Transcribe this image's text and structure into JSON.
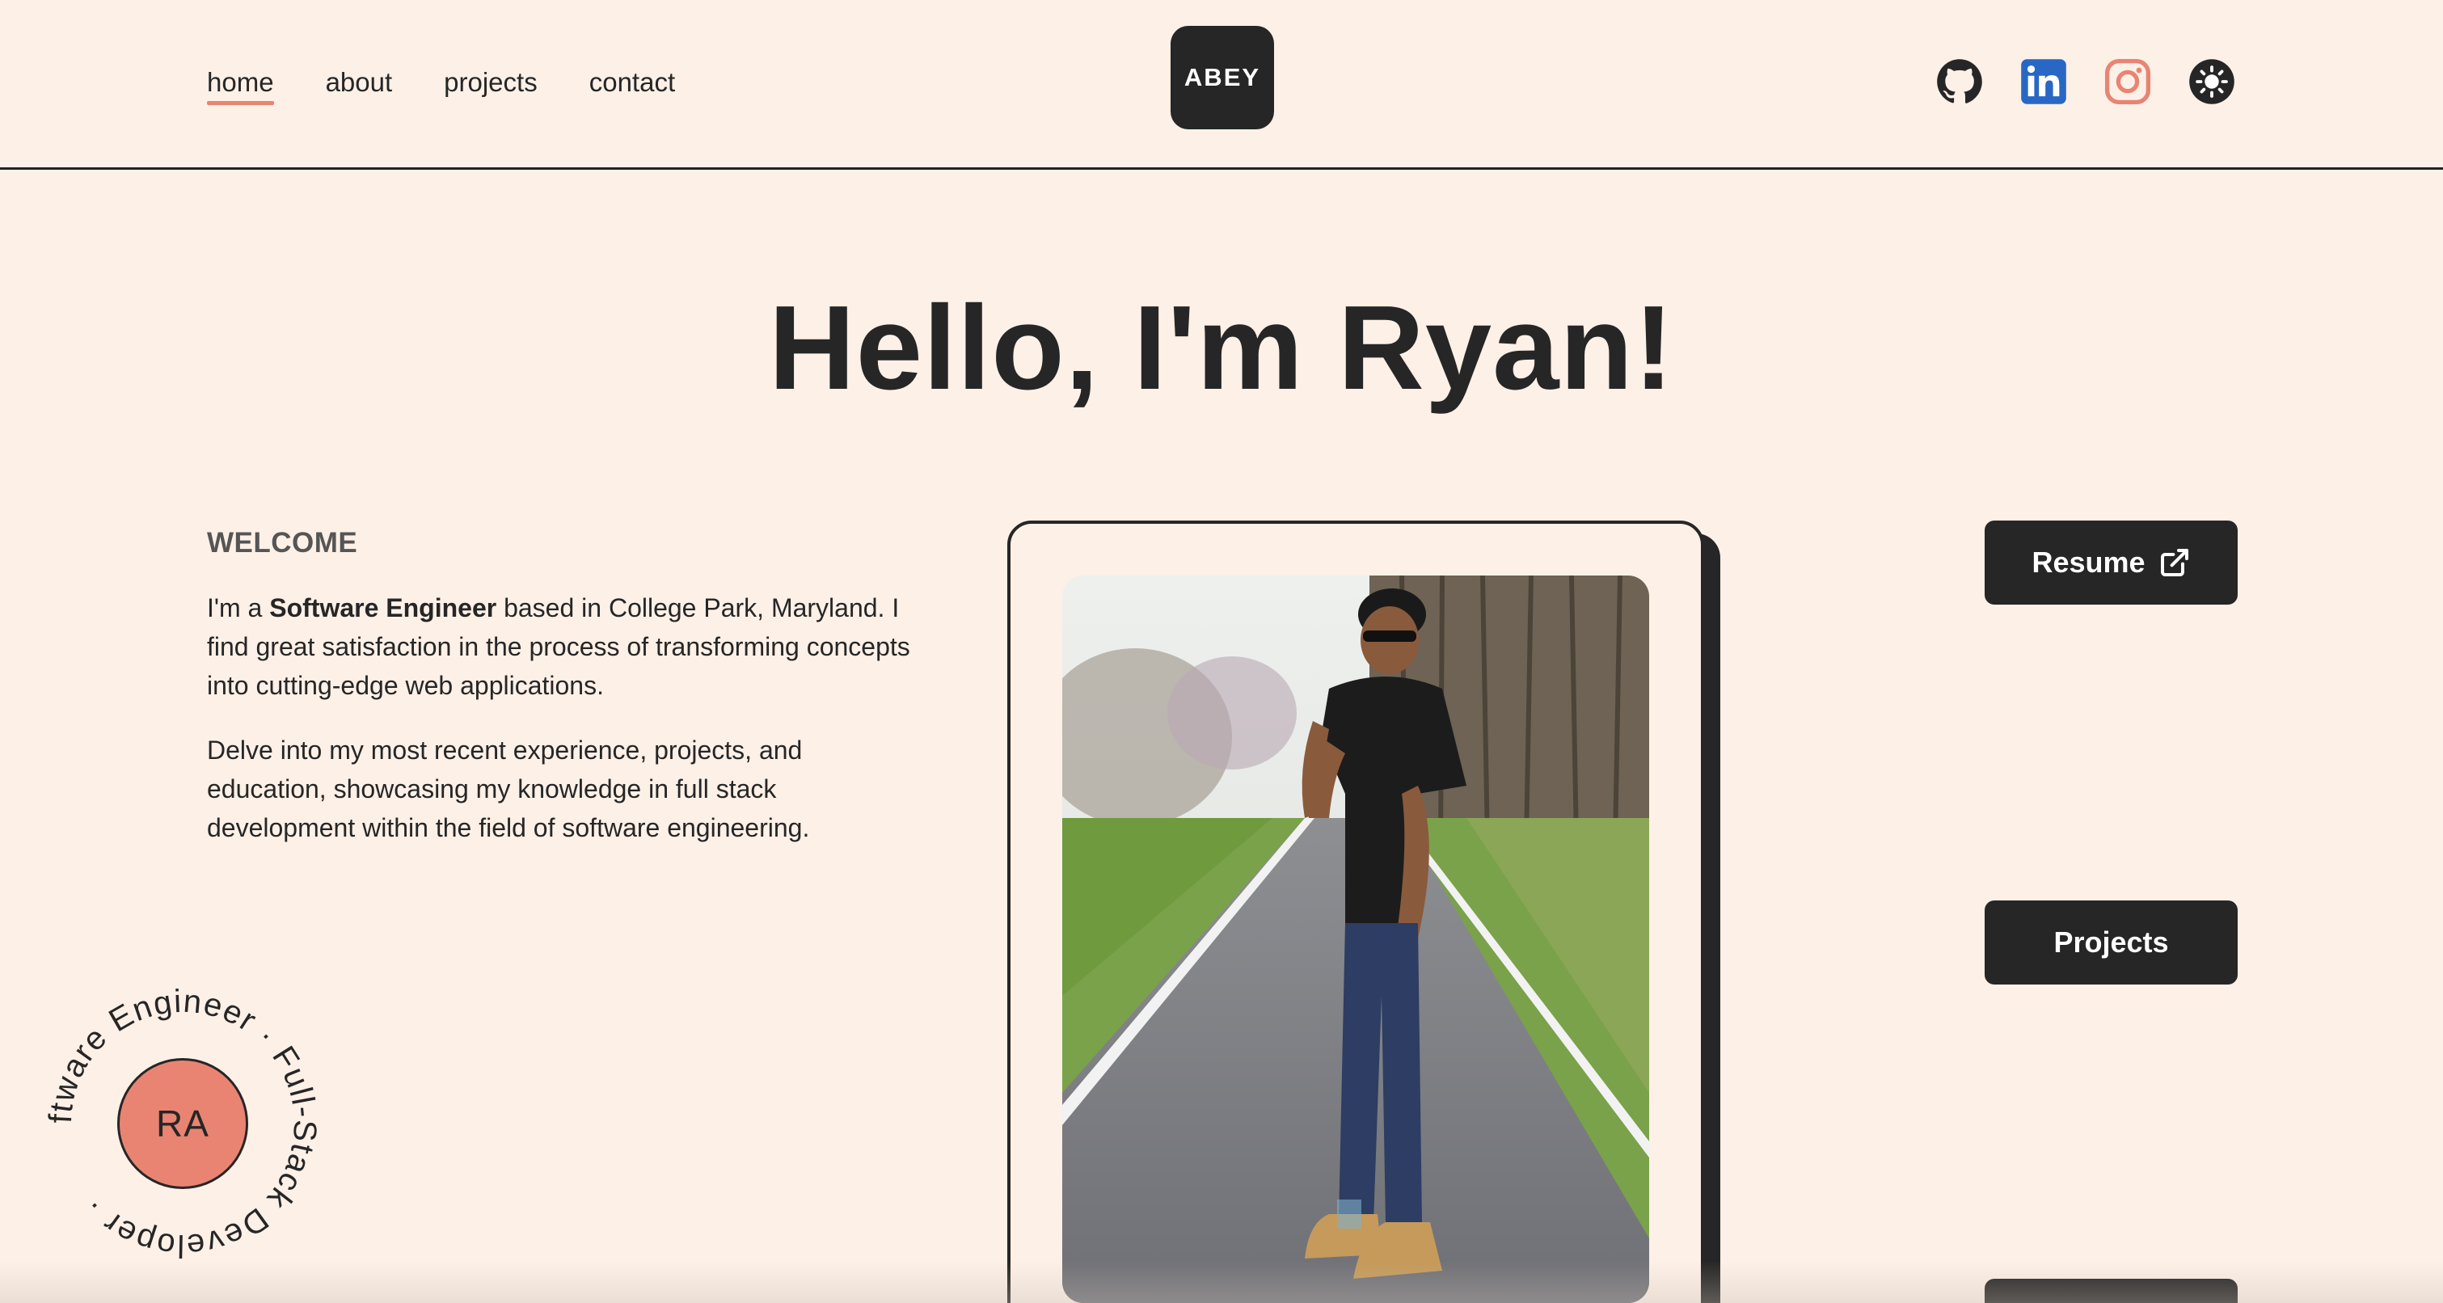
{
  "nav": {
    "links": [
      "home",
      "about",
      "projects",
      "contact"
    ],
    "active": "home",
    "logo_text": "ABEY",
    "socials": [
      {
        "icon": "github-icon",
        "color": "#262626"
      },
      {
        "icon": "linkedin-icon",
        "color": "#2867c4"
      },
      {
        "icon": "instagram-icon",
        "color": "#e98473"
      },
      {
        "icon": "theme-toggle-sun-icon",
        "color": "#262626"
      }
    ]
  },
  "hero": {
    "title": "Hello, I'm Ryan!"
  },
  "intro": {
    "welcome": "WELCOME",
    "p1_prefix": "I'm a ",
    "p1_bold": "Software Engineer",
    "p1_suffix": " based in College Park, Maryland. I find great satisfaction in the process of transforming concepts into cutting-edge web applications.",
    "p2": "Delve into my most recent experience, projects, and education, showcasing my knowledge in full stack development within the field of software engineering."
  },
  "buttons": {
    "resume": "Resume",
    "projects": "Projects"
  },
  "badge": {
    "initials": "RA",
    "ring_text": "Software Engineer · Full-Stack Developer · "
  },
  "colors": {
    "background": "#fdf0e7",
    "dark": "#262626",
    "accent": "#e98473",
    "linkedin": "#2867c4"
  }
}
